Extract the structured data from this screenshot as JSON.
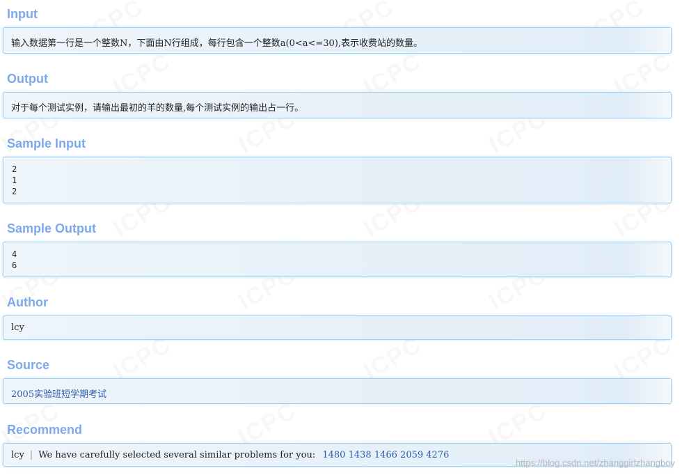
{
  "sections": {
    "input": {
      "title": "Input",
      "text": "输入数据第一行是一个整数N，下面由N行组成，每行包含一个整数a(0<a<=30),表示收费站的数量。"
    },
    "output": {
      "title": "Output",
      "text": "对于每个测试实例，请输出最初的羊的数量,每个测试实例的输出占一行。"
    },
    "sample_input": {
      "title": "Sample Input",
      "lines": [
        "2",
        "1",
        "2"
      ]
    },
    "sample_output": {
      "title": "Sample Output",
      "lines": [
        "4",
        "6"
      ]
    },
    "author": {
      "title": "Author",
      "text": "lcy"
    },
    "source": {
      "title": "Source",
      "text": "2005实验班短学期考试"
    },
    "recommend": {
      "title": "Recommend",
      "user": "lcy",
      "separator": "|",
      "text": "We have carefully selected several similar problems for you:",
      "problems": [
        "1480",
        "1438",
        "1466",
        "2059",
        "4276"
      ]
    }
  },
  "watermark": {
    "text": "ICPC",
    "url": "https://blog.csdn.net/zhanggirlzhangboy"
  },
  "colors": {
    "title": "#7ca9ed",
    "panel_border": "#9ed3f3",
    "link": "#2c5ca8"
  }
}
